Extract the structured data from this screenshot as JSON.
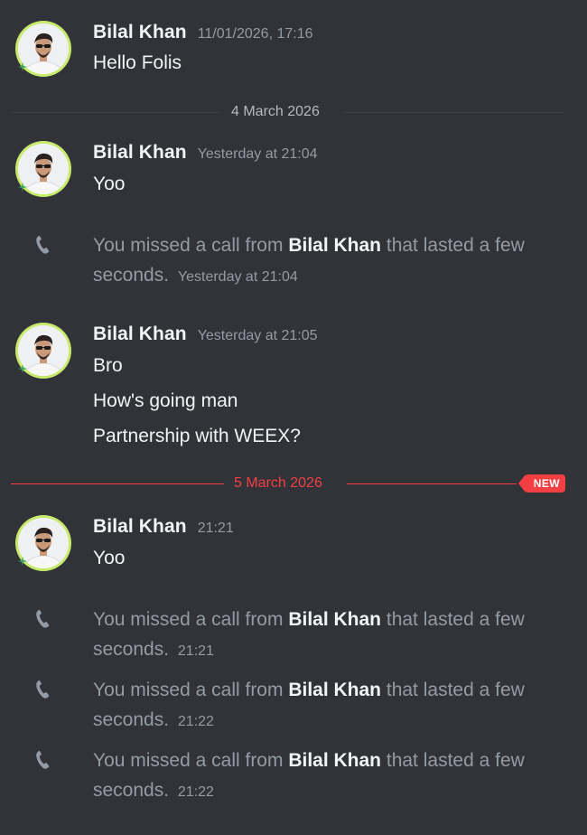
{
  "colors": {
    "background": "#313338",
    "text": "#f2f3f5",
    "muted": "#949ba4",
    "new_divider": "#f23f42",
    "avatar_ring": "#c7ea6a"
  },
  "messages": [
    {
      "author": "Bilal Khan",
      "timestamp": "11/01/2026, 17:16",
      "lines": [
        "Hello Folis"
      ]
    },
    {
      "author": "Bilal Khan",
      "timestamp": "Yesterday at 21:04",
      "lines": [
        "Yoo"
      ]
    },
    {
      "author": "Bilal Khan",
      "timestamp": "Yesterday at 21:05",
      "lines": [
        "Bro",
        "How's going man",
        "Partnership with WEEX?"
      ]
    },
    {
      "author": "Bilal Khan",
      "timestamp": "21:21",
      "lines": [
        "Yoo"
      ]
    }
  ],
  "dividers": [
    {
      "label": "4 March 2026"
    },
    {
      "label": "5 March 2026",
      "badge": "NEW"
    }
  ],
  "calls": [
    {
      "prefix": "You missed a call from",
      "caller": "Bilal Khan",
      "suffix": "that lasted a few seconds.",
      "time": "Yesterday at 21:04",
      "icon": "phone-icon"
    },
    {
      "prefix": "You missed a call from",
      "caller": "Bilal Khan",
      "suffix": "that lasted a few seconds.",
      "time": "21:21",
      "icon": "phone-icon"
    },
    {
      "prefix": "You missed a call from",
      "caller": "Bilal Khan",
      "suffix": "that lasted a few seconds.",
      "time": "21:22",
      "icon": "phone-icon"
    },
    {
      "prefix": "You missed a call from",
      "caller": "Bilal Khan",
      "suffix": "that lasted a few seconds.",
      "time": "21:22",
      "icon": "phone-icon"
    }
  ]
}
